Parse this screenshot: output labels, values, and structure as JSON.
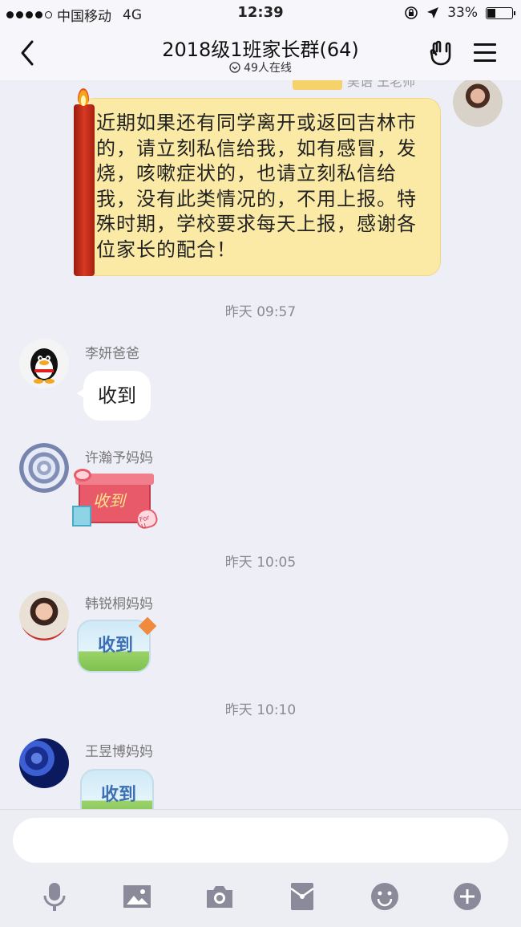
{
  "status_bar": {
    "carrier": "中国移动",
    "network": "4G",
    "time": "12:39",
    "battery": "33%",
    "battery_level": 0.33
  },
  "nav": {
    "title": "2018级1班家长群(64)",
    "online": "49人在线",
    "back_icon": "chevron-left-icon",
    "menu_icon": "hamburger-menu-icon",
    "hand_icon": "rock-hand-icon"
  },
  "messages": {
    "teacher_name_partial": "吴语 王老师",
    "announcement": "近期如果还有同学离开或返回吉林市的，请立刻私信给我，如有感冒，发烧，咳嗽症状的，也请立刻私信给我，没有此类情况的，不用上报。特殊时期，学校要求每天上报，感谢各位家长的配合！",
    "time1": "昨天 09:57",
    "sender1": "李妍爸爸",
    "text1": "收到",
    "sender2": "许瀚予妈妈",
    "sticker2_text": "收到",
    "sticker2_small": "For U",
    "time2": "昨天 10:05",
    "sender3": "韩锐桐妈妈",
    "sticker3_text": "收到",
    "time3": "昨天 10:10",
    "sender4": "王昱博妈妈",
    "sticker4_text": "收到"
  },
  "input": {
    "placeholder": ""
  },
  "toolbar": {
    "icons": [
      "microphone-icon",
      "image-icon",
      "camera-icon",
      "red-packet-icon",
      "emoji-icon",
      "plus-icon"
    ]
  },
  "colors": {
    "background": "#eeeef6",
    "announcement_bg": "#fbeaa6",
    "bubble": "#ffffff",
    "icon_gray": "#8a8a9a"
  }
}
